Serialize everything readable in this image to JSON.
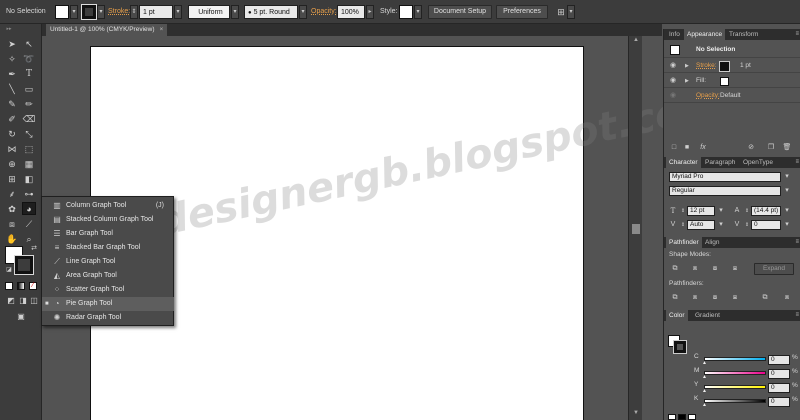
{
  "control_bar": {
    "selection_label": "No Selection",
    "stroke_label": "Stroke:",
    "stroke_weight": "1 pt",
    "profile_value": "Uniform",
    "brush_value": "5 pt. Round",
    "opacity_label": "Opacity:",
    "opacity_value": "100%",
    "style_label": "Style:",
    "document_setup_label": "Document Setup",
    "preferences_label": "Preferences"
  },
  "document_tab": {
    "title": "Untitled-1 @ 100% (CMYK/Preview)",
    "close": "×"
  },
  "watermark": "designergb.blogspot.co",
  "flyout": {
    "items": [
      {
        "label": "Column Graph Tool",
        "shortcut": "(J)",
        "icon": "column-graph-icon",
        "glyph": "▥"
      },
      {
        "label": "Stacked Column Graph Tool",
        "shortcut": "",
        "icon": "stacked-column-graph-icon",
        "glyph": "▤"
      },
      {
        "label": "Bar Graph Tool",
        "shortcut": "",
        "icon": "bar-graph-icon",
        "glyph": "☰"
      },
      {
        "label": "Stacked Bar Graph Tool",
        "shortcut": "",
        "icon": "stacked-bar-graph-icon",
        "glyph": "≡"
      },
      {
        "label": "Line Graph Tool",
        "shortcut": "",
        "icon": "line-graph-icon",
        "glyph": "⟋"
      },
      {
        "label": "Area Graph Tool",
        "shortcut": "",
        "icon": "area-graph-icon",
        "glyph": "◭"
      },
      {
        "label": "Scatter Graph Tool",
        "shortcut": "",
        "icon": "scatter-graph-icon",
        "glyph": "⁘"
      },
      {
        "label": "Pie Graph Tool",
        "shortcut": "",
        "icon": "pie-graph-icon",
        "glyph": "◔"
      },
      {
        "label": "Radar Graph Tool",
        "shortcut": "",
        "icon": "radar-graph-icon",
        "glyph": "✺"
      }
    ],
    "selected_index": 7
  },
  "panels": {
    "appearance_tabs": [
      "Info",
      "Appearance",
      "Transform"
    ],
    "appearance": {
      "title": "No Selection",
      "stroke_label": "Stroke:",
      "stroke_value": "1 pt",
      "fill_label": "Fill:",
      "opacity_label": "Opacity:",
      "opacity_value": "Default"
    },
    "character_tabs": [
      "Character",
      "Paragraph",
      "OpenType"
    ],
    "character": {
      "font_family": "Myriad Pro",
      "font_style": "Regular",
      "font_size": "12 pt",
      "leading": "(14.4 pt)",
      "kerning": "Auto",
      "tracking": "0"
    },
    "pathfinder_tabs": [
      "Pathfinder",
      "Align"
    ],
    "pathfinder": {
      "shape_modes_label": "Shape Modes:",
      "expand_label": "Expand",
      "pathfinders_label": "Pathfinders:"
    },
    "color_tabs": [
      "Color",
      "Gradient"
    ],
    "color": {
      "channels": [
        {
          "label": "C",
          "value": "0",
          "unit": "%",
          "gradient": "linear-gradient(to right,#fff,#00aeef)"
        },
        {
          "label": "M",
          "value": "0",
          "unit": "%",
          "gradient": "linear-gradient(to right,#fff,#ec008c)"
        },
        {
          "label": "Y",
          "value": "0",
          "unit": "%",
          "gradient": "linear-gradient(to right,#fff,#fff200)"
        },
        {
          "label": "K",
          "value": "0",
          "unit": "%",
          "gradient": "linear-gradient(to right,#fff,#000)"
        }
      ]
    }
  },
  "colors": {
    "orange_label": "#e79f4a",
    "ui_dark": "#3c3c3c",
    "ui_mid": "#535353"
  }
}
